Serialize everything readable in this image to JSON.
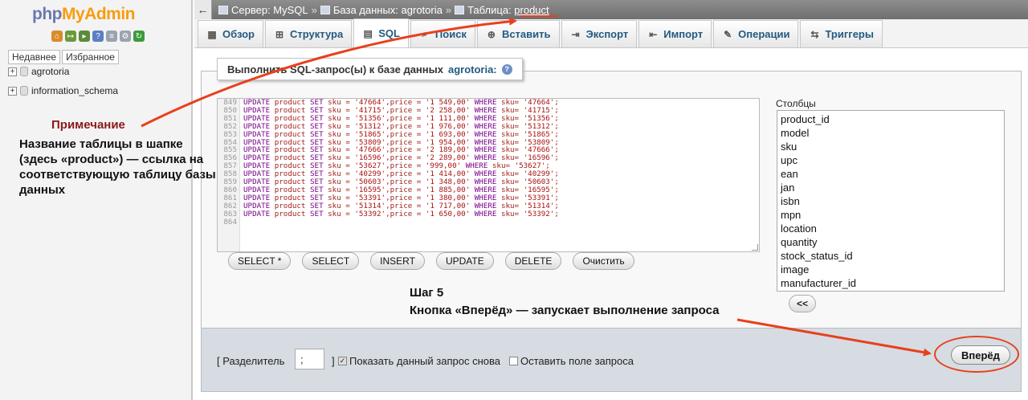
{
  "nav": {
    "logo_php": "php",
    "logo_myadmin": "MyAdmin",
    "icons": [
      {
        "name": "home-icon",
        "glyph": "⌂",
        "color": "#d98b2b"
      },
      {
        "name": "logout-icon",
        "glyph": "↦",
        "color": "#6a9a3a"
      },
      {
        "name": "sql-window-icon",
        "glyph": "▸",
        "color": "#5a8b3a"
      },
      {
        "name": "help-icon",
        "glyph": "?",
        "color": "#5b7fc4"
      },
      {
        "name": "docs-icon",
        "glyph": "≡",
        "color": "#9aa3ad"
      },
      {
        "name": "settings-icon",
        "glyph": "⚙",
        "color": "#9aa3ad"
      },
      {
        "name": "reload-icon",
        "glyph": "↻",
        "color": "#3b9b3b"
      }
    ],
    "tabs": [
      "Недавнее",
      "Избранное"
    ],
    "databases": [
      "agrotoria",
      "information_schema"
    ]
  },
  "annotation": {
    "title": "Примечание",
    "text": "Название таблицы в шапке (здесь «product»)  — ссылка на соответствующую таблицу базы данных",
    "step_title": "Шаг 5",
    "step_text": "Кнопка «Вперёд» — запускает выполнение запроса",
    "arrow_color": "#e8401c"
  },
  "header": {
    "back_glyph": "←",
    "server": "Сервер: MySQL",
    "sep": "»",
    "database": "База данных: agrotoria",
    "table_prefix": "Таблица: ",
    "table_name": "product"
  },
  "tabs": [
    {
      "label": "Обзор",
      "icon": "browse-icon",
      "glyph": "▦"
    },
    {
      "label": "Структура",
      "icon": "structure-icon",
      "glyph": "⊞"
    },
    {
      "label": "SQL",
      "icon": "sql-icon",
      "glyph": "▤",
      "active": true
    },
    {
      "label": "Поиск",
      "icon": "search-icon",
      "glyph": "⌕"
    },
    {
      "label": "Вставить",
      "icon": "insert-icon",
      "glyph": "⊕"
    },
    {
      "label": "Экспорт",
      "icon": "export-icon",
      "glyph": "⇥"
    },
    {
      "label": "Импорт",
      "icon": "import-icon",
      "glyph": "⇤"
    },
    {
      "label": "Операции",
      "icon": "operations-icon",
      "glyph": "✎"
    },
    {
      "label": "Триггеры",
      "icon": "triggers-icon",
      "glyph": "⇆"
    }
  ],
  "query": {
    "legend_prefix": "Выполнить SQL-запрос(ы) к базе данных",
    "legend_db": "agrotoria:",
    "line_numbers": [
      "849",
      "850",
      "851",
      "852",
      "853",
      "854",
      "855",
      "856",
      "857",
      "858",
      "859",
      "860",
      "861",
      "862",
      "863",
      "864"
    ],
    "rows": [
      {
        "sku": "47664",
        "price": "1 549,00"
      },
      {
        "sku": "41715",
        "price": "2 258,00"
      },
      {
        "sku": "51356",
        "price": "1 111,00"
      },
      {
        "sku": "51312",
        "price": "1 976,00"
      },
      {
        "sku": "51865",
        "price": "1 693,00"
      },
      {
        "sku": "53809",
        "price": "1 954,00"
      },
      {
        "sku": "47666",
        "price": "2 189,00"
      },
      {
        "sku": "16596",
        "price": "2 289,00"
      },
      {
        "sku": "53627",
        "price": "999,00"
      },
      {
        "sku": "40299",
        "price": "1 414,00"
      },
      {
        "sku": "50603",
        "price": "1 348,00"
      },
      {
        "sku": "16595",
        "price": "1 885,00"
      },
      {
        "sku": "53391",
        "price": "1 380,00"
      },
      {
        "sku": "51314",
        "price": "1 717,00"
      },
      {
        "sku": "53392",
        "price": "1 650,00"
      }
    ],
    "buttons": [
      "SELECT *",
      "SELECT",
      "INSERT",
      "UPDATE",
      "DELETE",
      "Очистить"
    ]
  },
  "columns": {
    "label": "Столбцы",
    "items": [
      "product_id",
      "model",
      "sku",
      "upc",
      "ean",
      "jan",
      "isbn",
      "mpn",
      "location",
      "quantity",
      "stock_status_id",
      "image",
      "manufacturer_id"
    ],
    "insert_button": "<<"
  },
  "footer": {
    "delimiter_label": "[ Разделитель",
    "delimiter_value": ";",
    "delimiter_close": "]",
    "show_query_label": "Показать данный запрос снова",
    "show_query_checked": true,
    "keep_box_label": "Оставить поле запроса",
    "keep_box_checked": false,
    "go_button": "Вперёд"
  }
}
